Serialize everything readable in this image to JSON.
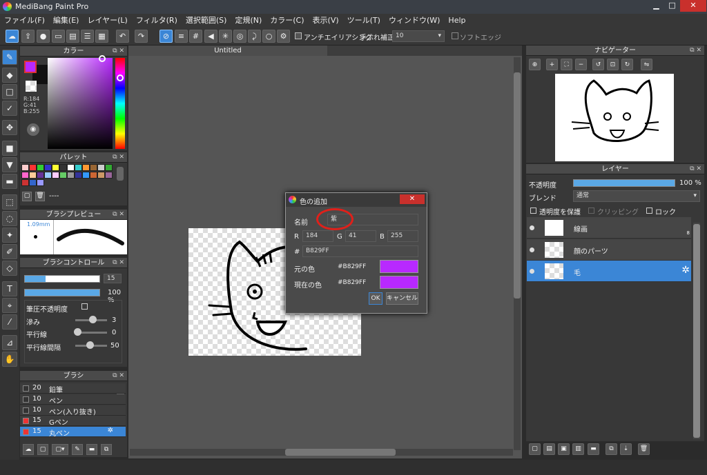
{
  "app": {
    "title": "MediBang Paint Pro"
  },
  "window_buttons": {
    "minimize": "▁",
    "maximize": "□",
    "close": "✕"
  },
  "menu": [
    "ファイル(F)",
    "編集(E)",
    "レイヤー(L)",
    "フィルタ(R)",
    "選択範囲(S)",
    "定規(N)",
    "カラー(C)",
    "表示(V)",
    "ツール(T)",
    "ウィンドウ(W)",
    "Help"
  ],
  "toolbar": {
    "antialias_label": "アンチエイリアシング",
    "stabilizer_label": "手ぶれ補正",
    "stabilizer_value": "10",
    "soft_edge_label": "ソフトエッジ"
  },
  "color_panel": {
    "title": "カラー",
    "r": "R:184",
    "g": "G:41",
    "b": "B:255",
    "fg_color": "#b829ff"
  },
  "palette_panel": {
    "title": "パレット",
    "status": "----",
    "swatches": [
      "#ffcccc",
      "#ff3333",
      "#33cc33",
      "#3333cc",
      "#ffff33",
      "#333333",
      "#ffffff",
      "#33cccc",
      "#ff9933",
      "#996633",
      "#cccccc",
      "#33aa33",
      "#ff66cc",
      "#ffcc99",
      "#663399",
      "#99ccff",
      "#ffccff",
      "#66cc66",
      "#999999",
      "#333399",
      "#3399ff",
      "#cc6633",
      "#cc9966",
      "#996699",
      "#cc3333",
      "#3366cc",
      "#9999ff"
    ]
  },
  "brush_preview": {
    "title": "ブラシプレビュー",
    "size": "1.09mm"
  },
  "brush_control": {
    "title": "ブラシコントロール",
    "size": "15",
    "opacity": "100 %",
    "pressure_label": "筆圧不透明度",
    "blur_label": "滲み",
    "blur_value": "3",
    "parallel_label": "平行線",
    "parallel_value": "0",
    "spacing_label": "平行線間隔",
    "spacing_value": "50"
  },
  "brush_panel": {
    "title": "ブラシ",
    "rows": [
      {
        "size": "20",
        "name": "鉛筆",
        "color": "#333333"
      },
      {
        "size": "10",
        "name": "ペン",
        "color": "#333333"
      },
      {
        "size": "10",
        "name": "ペン(入り抜き)",
        "color": "#333333"
      },
      {
        "size": "15",
        "name": "Gペン",
        "color": "#ee3333"
      },
      {
        "size": "15",
        "name": "丸ペン",
        "color": "#ee3333"
      }
    ]
  },
  "document": {
    "tab": "Untitled"
  },
  "dialog": {
    "title": "色の追加",
    "name_label": "名前",
    "name_value": "紫",
    "r_label": "R",
    "r_value": "184",
    "g_label": "G",
    "g_value": "41",
    "b_label": "B",
    "b_value": "255",
    "hash_label": "#",
    "hex_value": "B829FF",
    "orig_label": "元の色",
    "orig_hex": "#B829FF",
    "cur_label": "現在の色",
    "cur_hex": "#B829FF",
    "swatch_color": "#b829ff",
    "ok": "OK",
    "cancel": "キャンセル",
    "close": "✕"
  },
  "navigator": {
    "title": "ナビゲーター"
  },
  "layers": {
    "title": "レイヤー",
    "opacity_label": "不透明度",
    "opacity_value": "100 %",
    "blend_label": "ブレンド",
    "blend_value": "通常",
    "protect_label": "透明度を保護",
    "clip_label": "クリッピング",
    "lock_label": "ロック",
    "items": [
      {
        "name": "線画",
        "badge": "8"
      },
      {
        "name": "顔のパーツ"
      },
      {
        "name": "毛"
      }
    ]
  }
}
